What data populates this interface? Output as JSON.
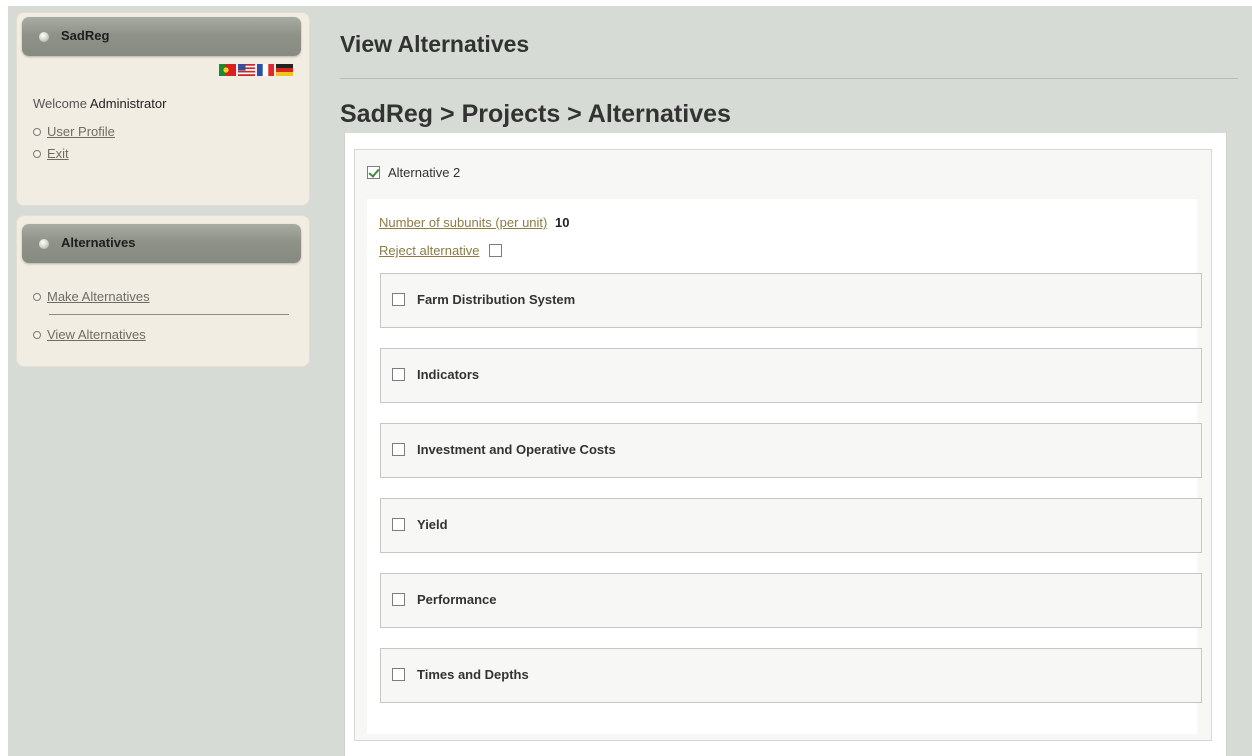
{
  "app": {
    "name": "SadReg"
  },
  "sidebar": {
    "user_panel": {
      "title": "SadReg",
      "flags": [
        "portugal-flag-icon",
        "usa-flag-icon",
        "france-flag-icon",
        "germany-flag-icon"
      ],
      "welcome_prefix": "Welcome",
      "user_name": "Administrator",
      "links": [
        {
          "label": "User Profile"
        },
        {
          "label": "Exit"
        }
      ]
    },
    "alternatives_panel": {
      "title": "Alternatives",
      "links": [
        {
          "label": "Make Alternatives"
        },
        {
          "label": "View Alternatives"
        }
      ]
    }
  },
  "main": {
    "page_title": "View Alternatives",
    "breadcrumb": "SadReg > Projects > Alternatives",
    "alternative": {
      "label": "Alternative 2",
      "checked": true,
      "subunits_label": "Number of subunits (per unit)",
      "subunits_value": "10",
      "reject_label": "Reject alternative",
      "reject_checked": false,
      "sections": [
        {
          "label": "Farm Distribution System",
          "checked": false
        },
        {
          "label": "Indicators",
          "checked": false
        },
        {
          "label": "Investment and Operative Costs",
          "checked": false
        },
        {
          "label": "Yield",
          "checked": false
        },
        {
          "label": "Performance",
          "checked": false
        },
        {
          "label": "Times and Depths",
          "checked": false
        }
      ]
    }
  },
  "colors": {
    "page_background": "#d7dbd5",
    "panel_background": "#f1ede3",
    "panel_header": "#8f9288",
    "link_gold": "#8d7b43",
    "checkmark": "#3a8a3a"
  }
}
